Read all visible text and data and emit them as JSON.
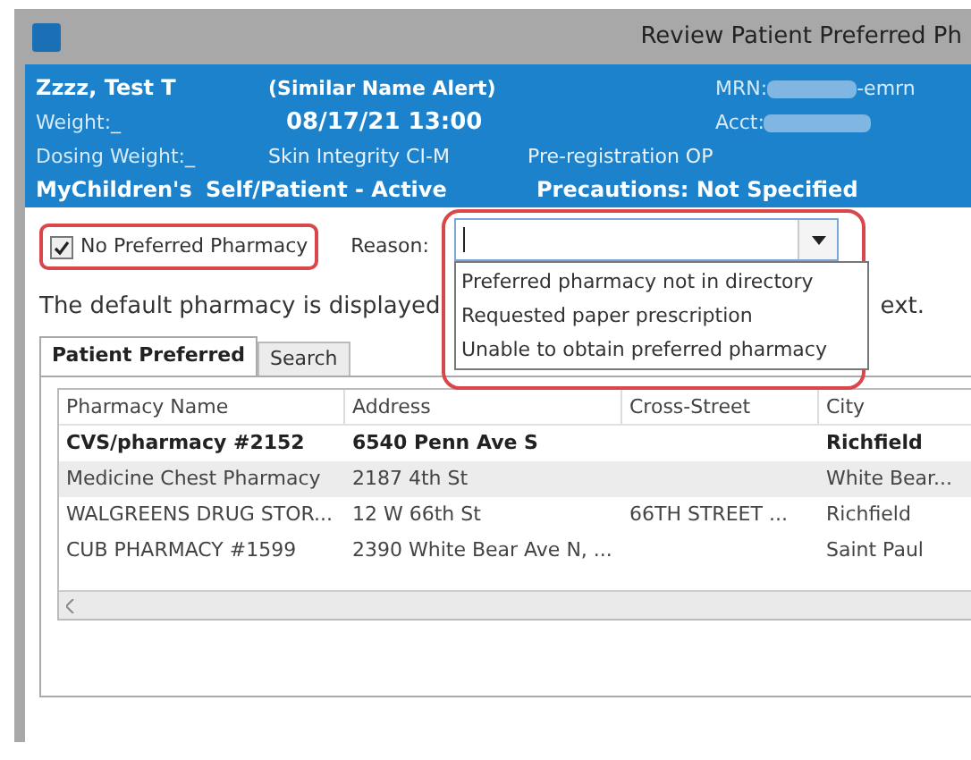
{
  "window": {
    "title": "Review Patient Preferred Ph"
  },
  "banner": {
    "name": "Zzzz, Test T",
    "alert": "(Similar Name Alert)",
    "mrn_label": "MRN:",
    "mrn_suffix": "-emrn",
    "weight": "Weight:_",
    "date": "08/17/21 13:00",
    "acct_label": "Acct:",
    "dosing_weight": "Dosing Weight:_",
    "unit": "Skin Integrity CI-M",
    "encounter": "Pre-registration OP",
    "org": "MyChildren's",
    "status": "Self/Patient - Active",
    "precautions": "Precautions: Not Specified"
  },
  "no_pharmacy": {
    "label": "No Preferred Pharmacy",
    "checked": true
  },
  "reason": {
    "label": "Reason:",
    "options": [
      "Preferred pharmacy not in directory",
      "Requested paper prescription",
      "Unable to obtain preferred pharmacy"
    ]
  },
  "notice": {
    "start": "The default pharmacy is displayed",
    "end": "ext."
  },
  "tabs": [
    {
      "label": "Patient Preferred",
      "selected": true
    },
    {
      "label": "Search",
      "selected": false
    }
  ],
  "table": {
    "columns": [
      "Pharmacy Name",
      "Address",
      "Cross-Street",
      "City"
    ],
    "rows": [
      {
        "cells": [
          "CVS/pharmacy #2152",
          "6540 Penn Ave S",
          "",
          "Richfield"
        ],
        "default": true,
        "selected": false
      },
      {
        "cells": [
          "Medicine Chest Pharmacy",
          "2187 4th St",
          "",
          "White Bear..."
        ],
        "default": false,
        "selected": true
      },
      {
        "cells": [
          "WALGREENS DRUG STOR...",
          "12 W 66th St",
          "66TH STREET ...",
          "Richfield"
        ],
        "default": false,
        "selected": false
      },
      {
        "cells": [
          "CUB PHARMACY #1599",
          "2390 White Bear Ave N, ...",
          "",
          "Saint Paul"
        ],
        "default": false,
        "selected": false
      }
    ]
  }
}
